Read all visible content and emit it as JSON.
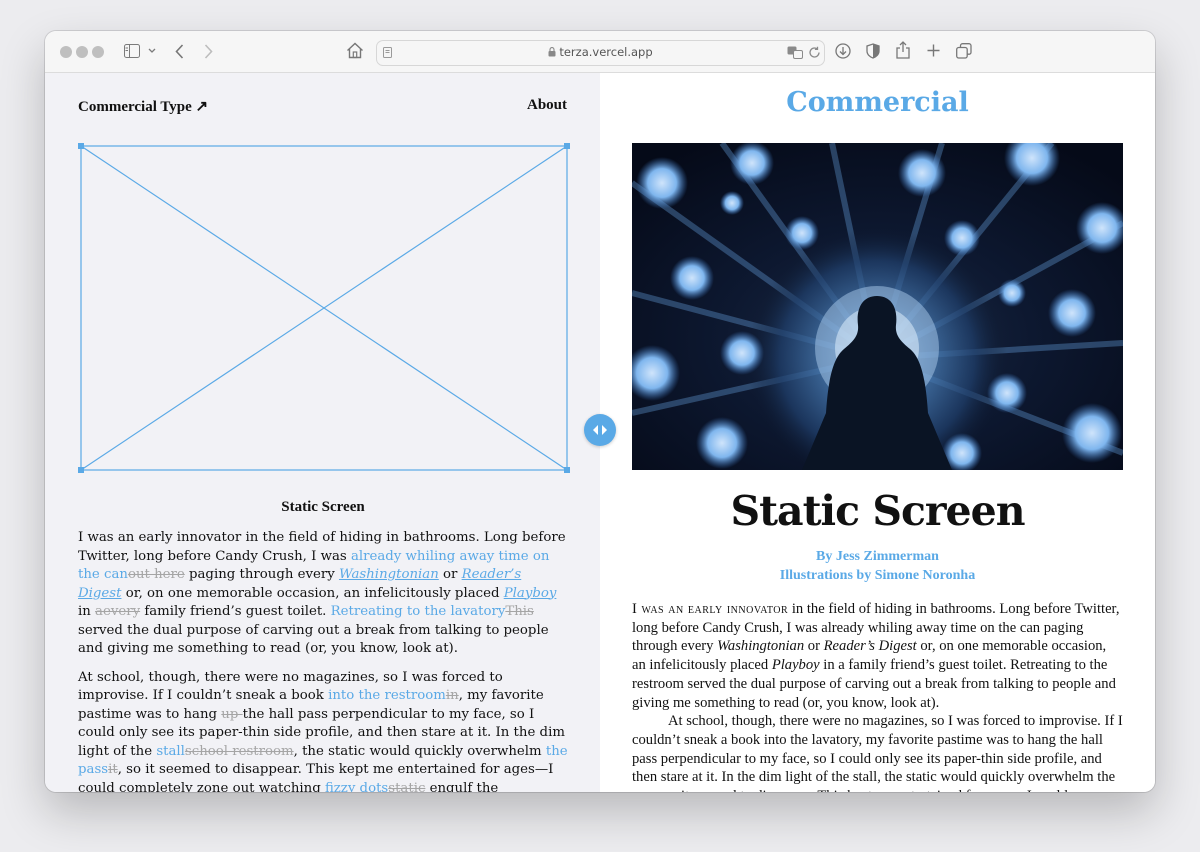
{
  "browser": {
    "url": "terza.vercel.app"
  },
  "left": {
    "nav_brand": "Commercial Type ↗",
    "nav_about": "About",
    "heading": "Static Screen",
    "p1": {
      "t1": "I was an early innovator in the field of hiding in bathrooms. Long before Twitter, long before Candy Crush, I was ",
      "b1": "already whiling away time on the can",
      "s1": "out here",
      "t2": " paging through every ",
      "i1": "Washingtonian",
      "t3": " or ",
      "i2": "Reader’s Digest",
      "t4": " or, on one memorable occasion, an infelicitously placed ",
      "i3": "Playboy",
      "t5": " in ",
      "s2": "aevery",
      "t6": " family friend’s guest toilet. ",
      "b2": "Retreating to the lavatory",
      "s3": "This",
      "t7": " served the dual purpose of carving out a break from talking to people and giving me something to read (or, you know, look at)."
    },
    "p2": {
      "t1": "At school, though, there were no magazines, so I was forced to improvise. If I couldn’t sneak a book ",
      "b1": "into the restroom",
      "s1": "in",
      "t2": ", my favorite pastime was to hang ",
      "s2": "up ",
      "t3": "the hall pass perpendicular to my face, so I could only see its paper-thin side profile, and then stare at it. In the dim light of the ",
      "b2": "stall",
      "s3": "school restroom",
      "t4": ", the static would quickly overwhelm ",
      "b3": "the pass",
      "s4": "it",
      "t5": ", so it seemed to disappear. This kept me entertained for ages—I could completely zone out watching ",
      "b4": "fizzy dots",
      "s5": "static",
      "t6": " engulf the laminated edge."
    }
  },
  "right": {
    "masthead": "Commercial",
    "title": "Static Screen",
    "byline1": "By Jess Zimmerman",
    "byline2": "Illustrations by Simone Noronha",
    "p1": {
      "lead": "I was an early innovator",
      "t1": " in the field of hiding in bathrooms. Long before Twitter, long before Candy Crush, I was already whiling away time on the can paging through every ",
      "i1": "Washingtonian",
      "t2": " or ",
      "i2": "Reader’s Digest",
      "t3": " or, on one memorable occasion, an infelicitously placed ",
      "i3": "Playboy",
      "t4": " in a family friend’s guest toilet. Retreating to the restroom served the dual purpose of carving out a break from talking to people and giving me something to read (or, you know, look at)."
    },
    "p2": "At school, though, there were no magazines, so I was forced to improvise. If I couldn’t sneak a book into the lavatory, my favorite pastime was to hang the hall pass perpendicular to my face, so I could only see its paper-thin side profile, and then stare at it. In the dim light of the stall, the static would quickly overwhelm the pass, so it seemed to disappear. This kept me entertained for ages—I could completely zone out watching fizzy dots engulf the laminated edge."
  },
  "colors": {
    "accent": "#5aa9e6",
    "pane_left_bg": "#f2f2f6",
    "pane_right_bg": "#ffffff"
  },
  "icons": [
    "close-icon",
    "sidebar-icon",
    "chevron-down-icon",
    "back-icon",
    "forward-icon",
    "home-icon",
    "page-icon",
    "lock-icon",
    "translate-icon",
    "reload-icon",
    "download-icon",
    "privacy-shield-icon",
    "share-icon",
    "new-tab-icon",
    "tabs-overview-icon",
    "drag-handle-icon"
  ]
}
